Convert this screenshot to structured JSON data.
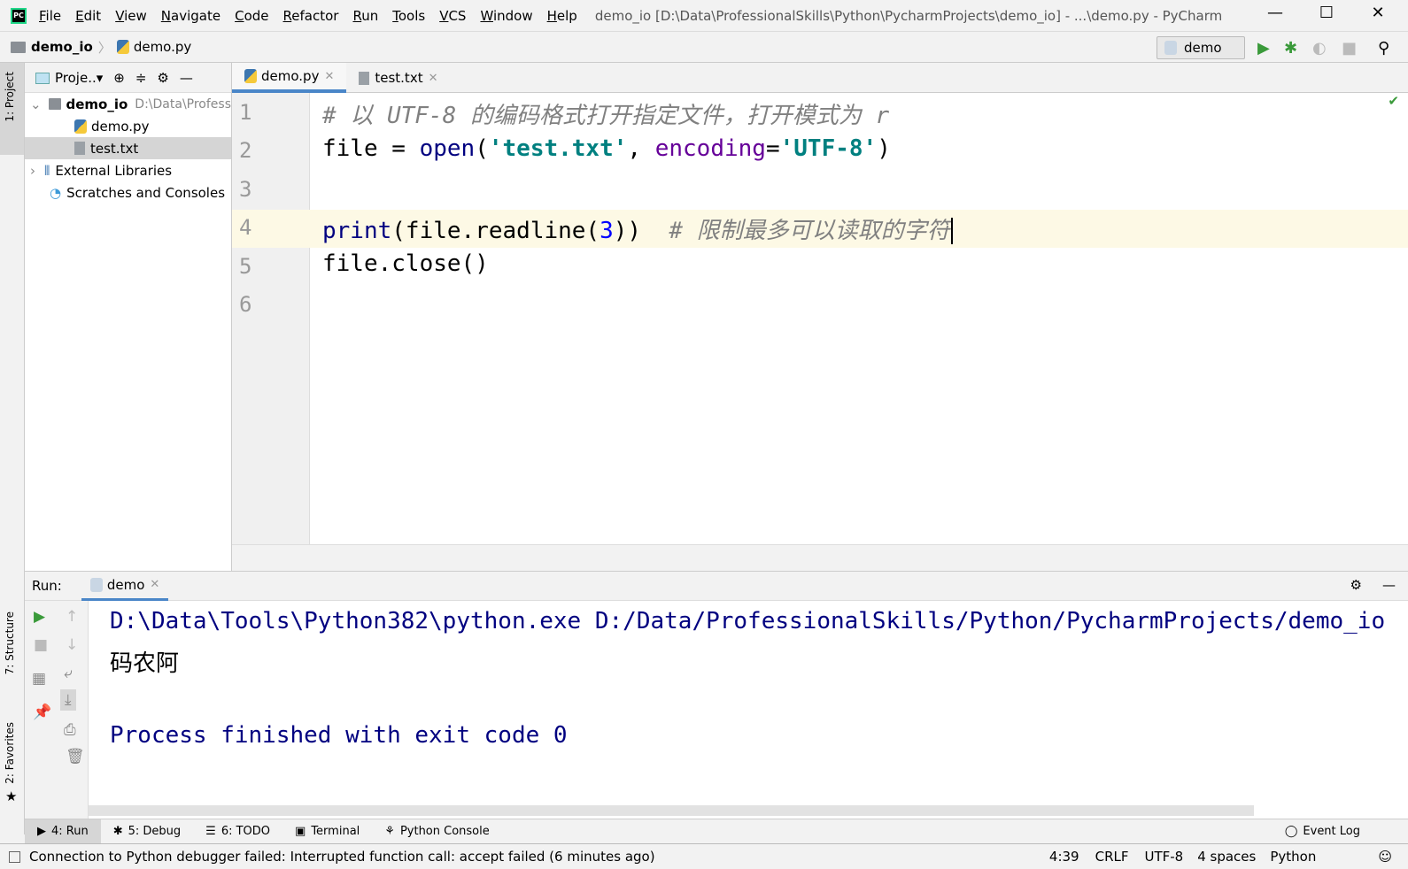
{
  "window": {
    "title": "demo_io [D:\\Data\\ProfessionalSkills\\Python\\PycharmProjects\\demo_io] - ...\\demo.py - PyCharm"
  },
  "menu": [
    "File",
    "Edit",
    "View",
    "Navigate",
    "Code",
    "Refactor",
    "Run",
    "Tools",
    "VCS",
    "Window",
    "Help"
  ],
  "breadcrumb": {
    "project": "demo_io",
    "file": "demo.py"
  },
  "run_config": "demo",
  "side_tabs": {
    "project": "1: Project",
    "structure": "7: Structure",
    "favorites": "2: Favorites"
  },
  "project_panel": {
    "title": "Proje..",
    "root": "demo_io",
    "root_path": "D:\\Data\\Profess",
    "files": [
      "demo.py",
      "test.txt"
    ],
    "external": "External Libraries",
    "scratches": "Scratches and Consoles"
  },
  "editor_tabs": [
    {
      "label": "demo.py",
      "active": true
    },
    {
      "label": "test.txt",
      "active": false
    }
  ],
  "line_numbers": [
    "1",
    "2",
    "3",
    "4",
    "5",
    "6"
  ],
  "code": {
    "l1": "# 以 UTF-8 的编码格式打开指定文件，打开模式为 r",
    "l2": {
      "a": "file = ",
      "b": "open",
      "c": "(",
      "d": "'test.txt'",
      "e": ", ",
      "f": "encoding",
      "g": "=",
      "h": "'UTF-8'",
      "i": ")"
    },
    "l4": {
      "a": "print",
      "b": "(file.readline(",
      "c": "3",
      "d": "))",
      "e": "  # 限制最多可以读取的字符"
    },
    "l5": "file.close()"
  },
  "run": {
    "label": "Run:",
    "tab": "demo",
    "output": [
      "D:\\Data\\Tools\\Python382\\python.exe D:/Data/ProfessionalSkills/Python/PycharmProjects/demo_io",
      "码农阿",
      "",
      "Process finished with exit code 0"
    ]
  },
  "bottom_tabs": [
    "4: Run",
    "5: Debug",
    "6: TODO",
    "Terminal",
    "Python Console"
  ],
  "event_log": "Event Log",
  "status": {
    "message": "Connection to Python debugger failed: Interrupted function call: accept failed (6 minutes ago)",
    "position": "4:39",
    "line_sep": "CRLF",
    "encoding": "UTF-8",
    "indent": "4 spaces",
    "interpreter": "Python"
  },
  "colors": {
    "accent": "#4a86c8",
    "string": "#008080",
    "keyword_arg": "#660099",
    "builtin": "#000080",
    "comment": "#808080",
    "run_green": "#3a9a3a"
  }
}
